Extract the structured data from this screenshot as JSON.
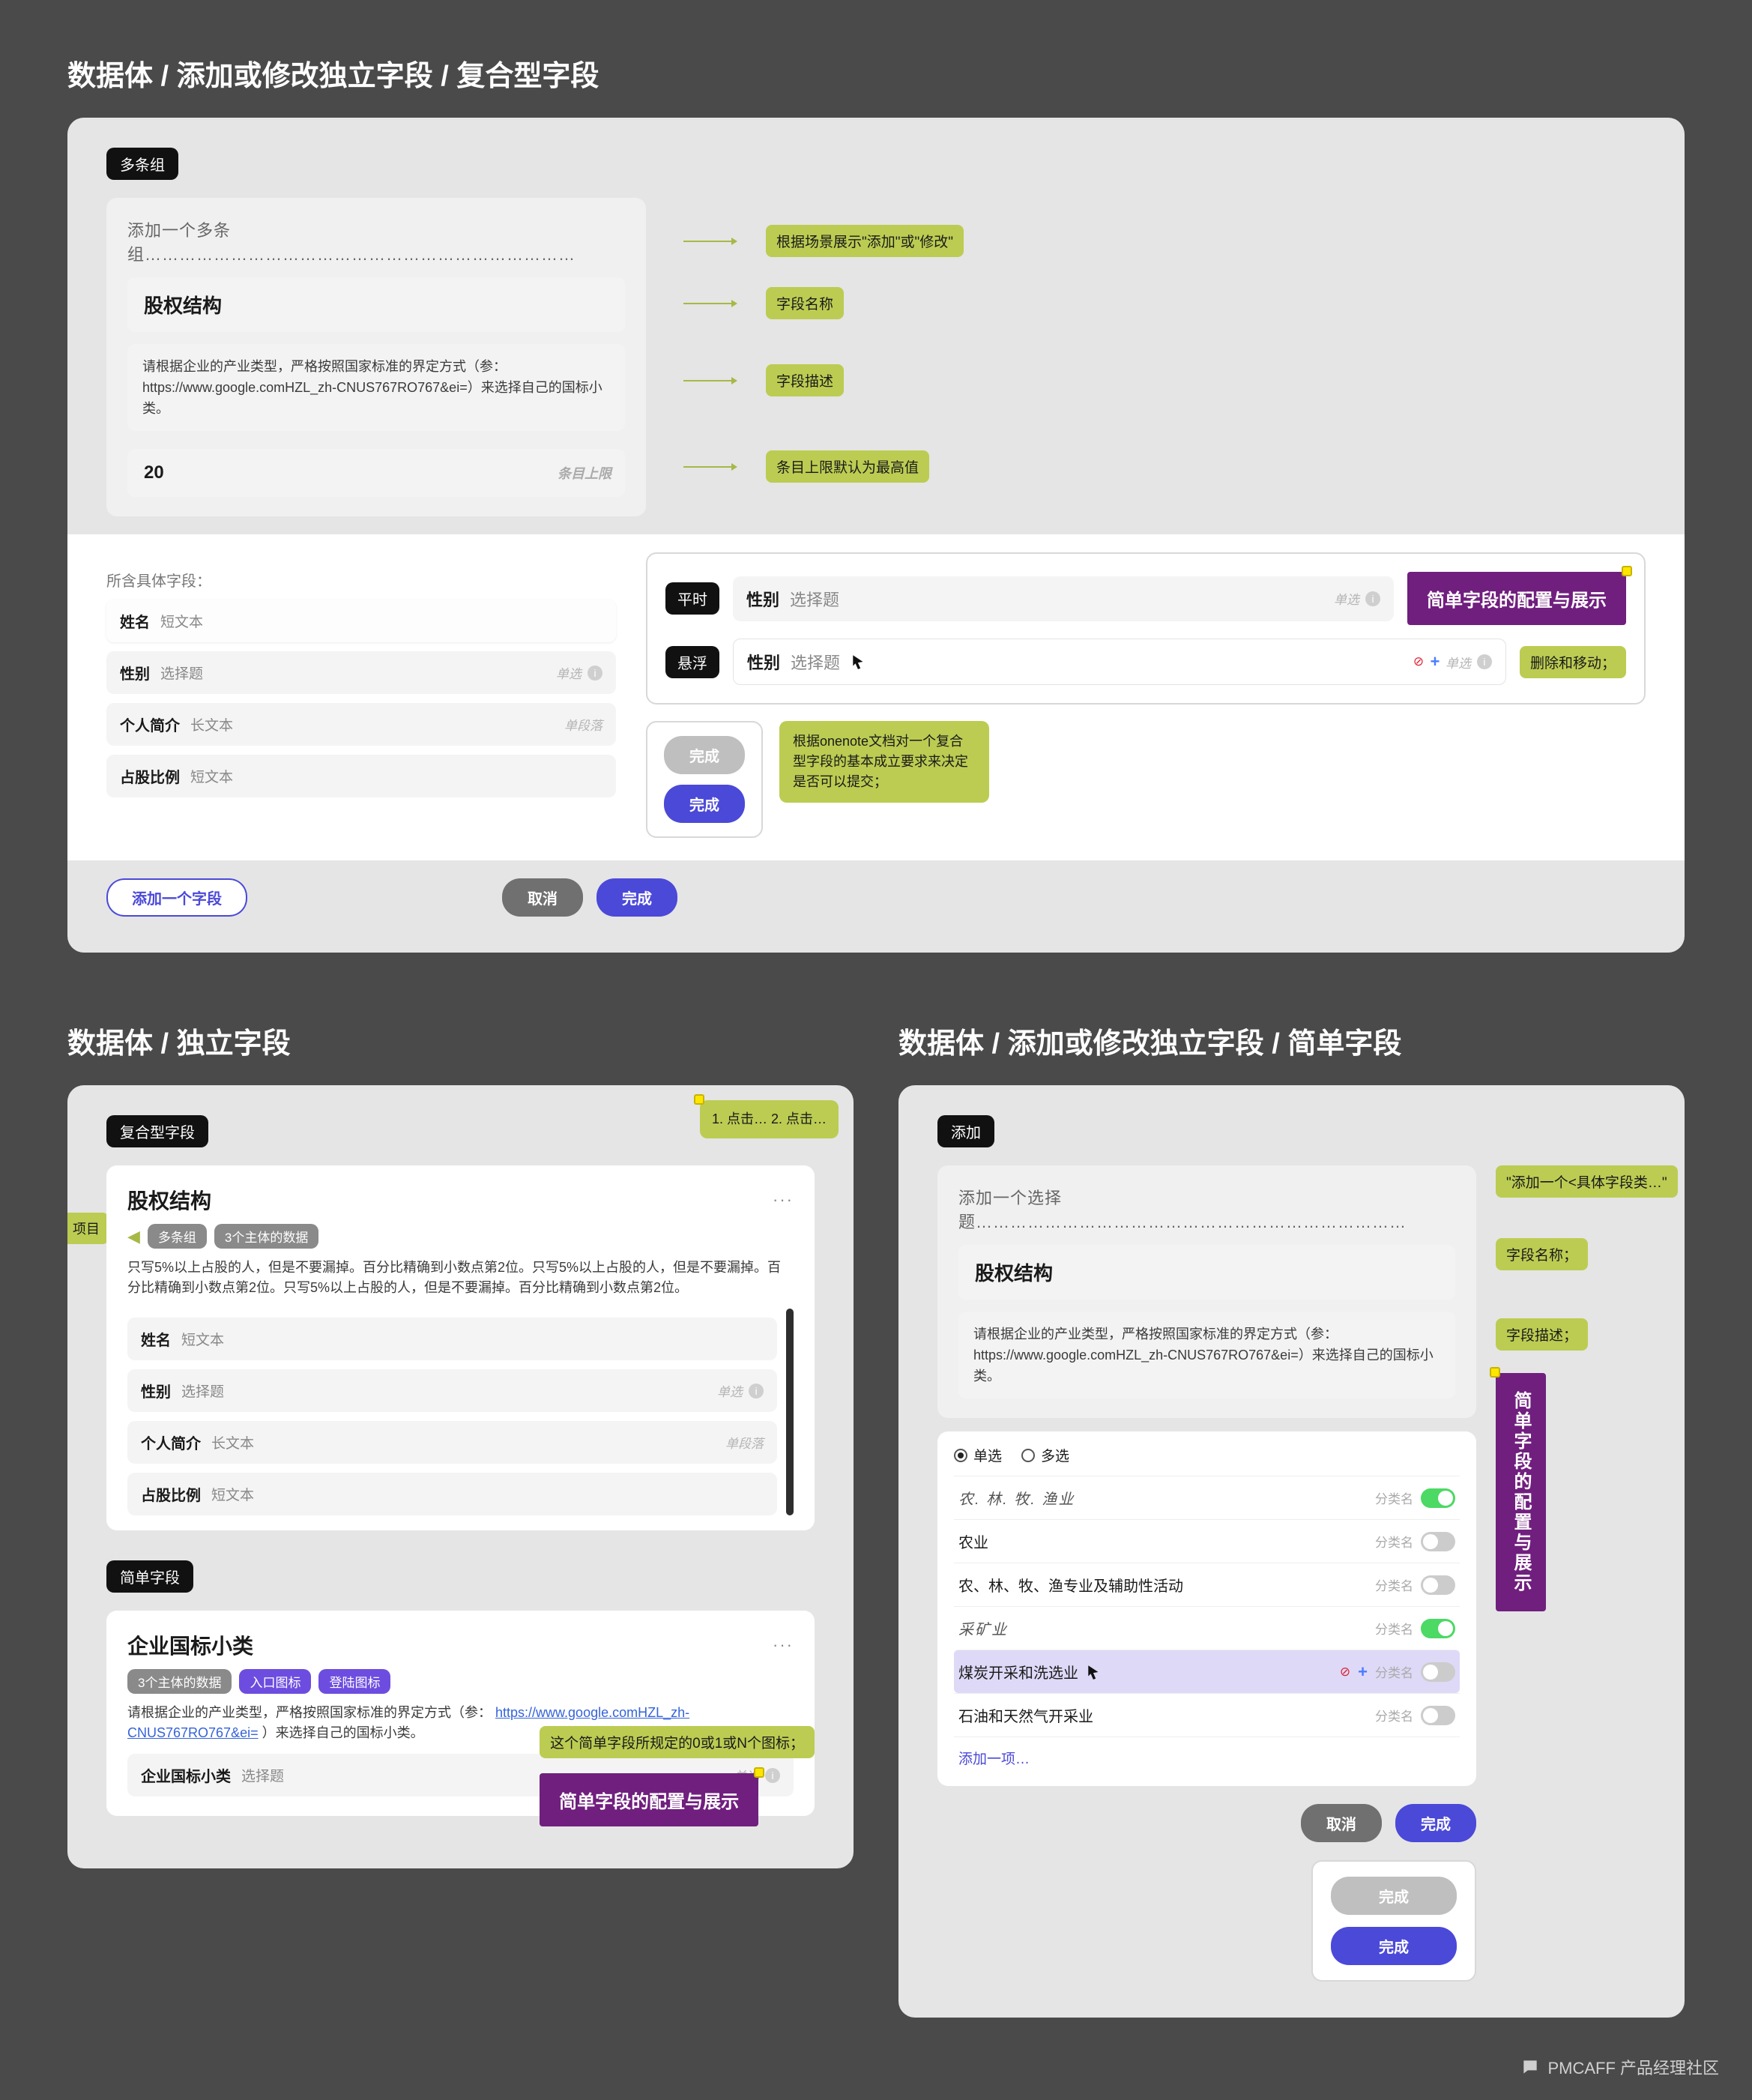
{
  "headings": {
    "panel1": "数据体 / 添加或修改独立字段 / 复合型字段",
    "panel2": "数据体 / 独立字段",
    "panel3": "数据体 / 添加或修改独立字段 / 简单字段"
  },
  "tags": {
    "multi_group": "多条组",
    "compound_field": "复合型字段",
    "simple_field": "简单字段",
    "add": "添加",
    "flat": "平时",
    "hover": "悬浮"
  },
  "form1": {
    "prompt": "添加一个多条组…………………………………………………………………",
    "title": "股权结构",
    "desc": "请根据企业的产业类型，严格按照国家标准的界定方式（参：https://www.google.comHZL_zh-CNUS767RO767&ei=）来选择自己的国标小类。",
    "limit_value": "20",
    "limit_hint": "条目上限",
    "section_label": "所含具体字段：",
    "fields": [
      {
        "name": "姓名",
        "type": "短文本",
        "meta": ""
      },
      {
        "name": "性别",
        "type": "选择题",
        "meta": "单选"
      },
      {
        "name": "个人简介",
        "type": "长文本",
        "meta": "单段落"
      },
      {
        "name": "占股比例",
        "type": "短文本",
        "meta": ""
      }
    ],
    "add_field_btn": "添加一个字段",
    "cancel": "取消",
    "submit": "完成"
  },
  "anno1": {
    "context": "根据场景展示\"添加\"或\"修改\"",
    "name": "字段名称",
    "desc": "字段描述",
    "limit": "条目上限默认为最高值",
    "simple_config": "简单字段的配置与展示",
    "delete_move": "删除和移动；",
    "complete_note": "根据onenote文档对一个复合型字段的基本成立要求来决定是否可以提交；",
    "done": "完成",
    "simple_config_badge": "简单字段的配置与展示"
  },
  "state_rows": {
    "a": {
      "name": "性别",
      "type": "选择题",
      "meta": "单选"
    },
    "b": {
      "name": "性别",
      "type": "选择题",
      "meta": "单选"
    }
  },
  "panel2": {
    "card1": {
      "title": "股权结构",
      "chips": [
        "多条组",
        "3个主体的数据"
      ],
      "desc": "只写5%以上占股的人，但是不要漏掉。百分比精确到小数点第2位。只写5%以上占股的人，但是不要漏掉。百分比精确到小数点第2位。只写5%以上占股的人，但是不要漏掉。百分比精确到小数点第2位。",
      "fields": [
        {
          "name": "姓名",
          "type": "短文本",
          "meta": ""
        },
        {
          "name": "性别",
          "type": "选择题",
          "meta": "单选"
        },
        {
          "name": "个人简介",
          "type": "长文本",
          "meta": "单段落"
        },
        {
          "name": "占股比例",
          "type": "短文本",
          "meta": ""
        }
      ]
    },
    "left_chip": "项目",
    "side_note": "1. 点击…\n2. 点击…",
    "card2": {
      "title": "企业国标小类",
      "chips": [
        "3个主体的数据",
        "入口图标",
        "登陆图标"
      ],
      "desc_prefix": "请根据企业的产业类型，严格按照国家标准的界定方式（参：",
      "desc_link": "https://www.google.comHZL_zh-CNUS767RO767&ei=",
      "desc_suffix": "）来选择自己的国标小类。",
      "field": {
        "name": "企业国标小类",
        "type": "选择题",
        "meta": "单选"
      }
    },
    "anno": {
      "per_body": "这个简单字段所规定的0或1或N个图标；",
      "badge": "简单字段的配置与展示"
    }
  },
  "panel3": {
    "prompt": "添加一个选择题…………………………………………………………………",
    "title": "股权结构",
    "desc": "请根据企业的产业类型，严格按照国家标准的界定方式（参：https://www.google.comHZL_zh-CNUS767RO767&ei=）来选择自己的国标小类。",
    "radio_single": "单选",
    "radio_multi": "多选",
    "cat_label": "分类名",
    "groups": [
      {
        "label": "农. 林. 牧. 渔业",
        "header": true,
        "on": true
      },
      {
        "label": "农业",
        "header": false,
        "on": false
      },
      {
        "label": "农、林、牧、渔专业及辅助性活动",
        "header": false,
        "on": false
      },
      {
        "label": "采矿业",
        "header": true,
        "on": true
      },
      {
        "label": "煤炭开采和洗选业",
        "header": false,
        "on": false,
        "selected": true
      },
      {
        "label": "石油和天然气开采业",
        "header": false,
        "on": false
      }
    ],
    "add_one": "添加一项…",
    "cancel": "取消",
    "submit": "完成",
    "done_label": "完成",
    "anno": {
      "prefix": "\"添加一个<具体字段类…\"",
      "name": "字段名称；",
      "desc": "字段描述；",
      "vertical": "简单字段的配置与展示"
    }
  },
  "footer": "PMCAFF 产品经理社区"
}
